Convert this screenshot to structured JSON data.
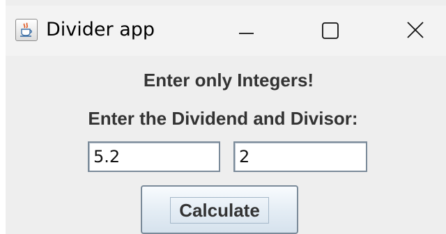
{
  "window": {
    "title": "Divider app",
    "icon": "java-cup-icon",
    "controls": [
      "minimize-icon",
      "maximize-icon",
      "close-icon"
    ]
  },
  "form": {
    "heading": "Enter only Integers!",
    "prompt": "Enter the Dividend and Divisor:",
    "dividend_value": "5.2",
    "divisor_value": "2",
    "calculate_label": "Calculate"
  },
  "colors": {
    "window_bg": "#eeeeee",
    "titlebar_bg": "#f3f3f3",
    "label_text": "#333333",
    "field_border": "#7a8a99"
  }
}
